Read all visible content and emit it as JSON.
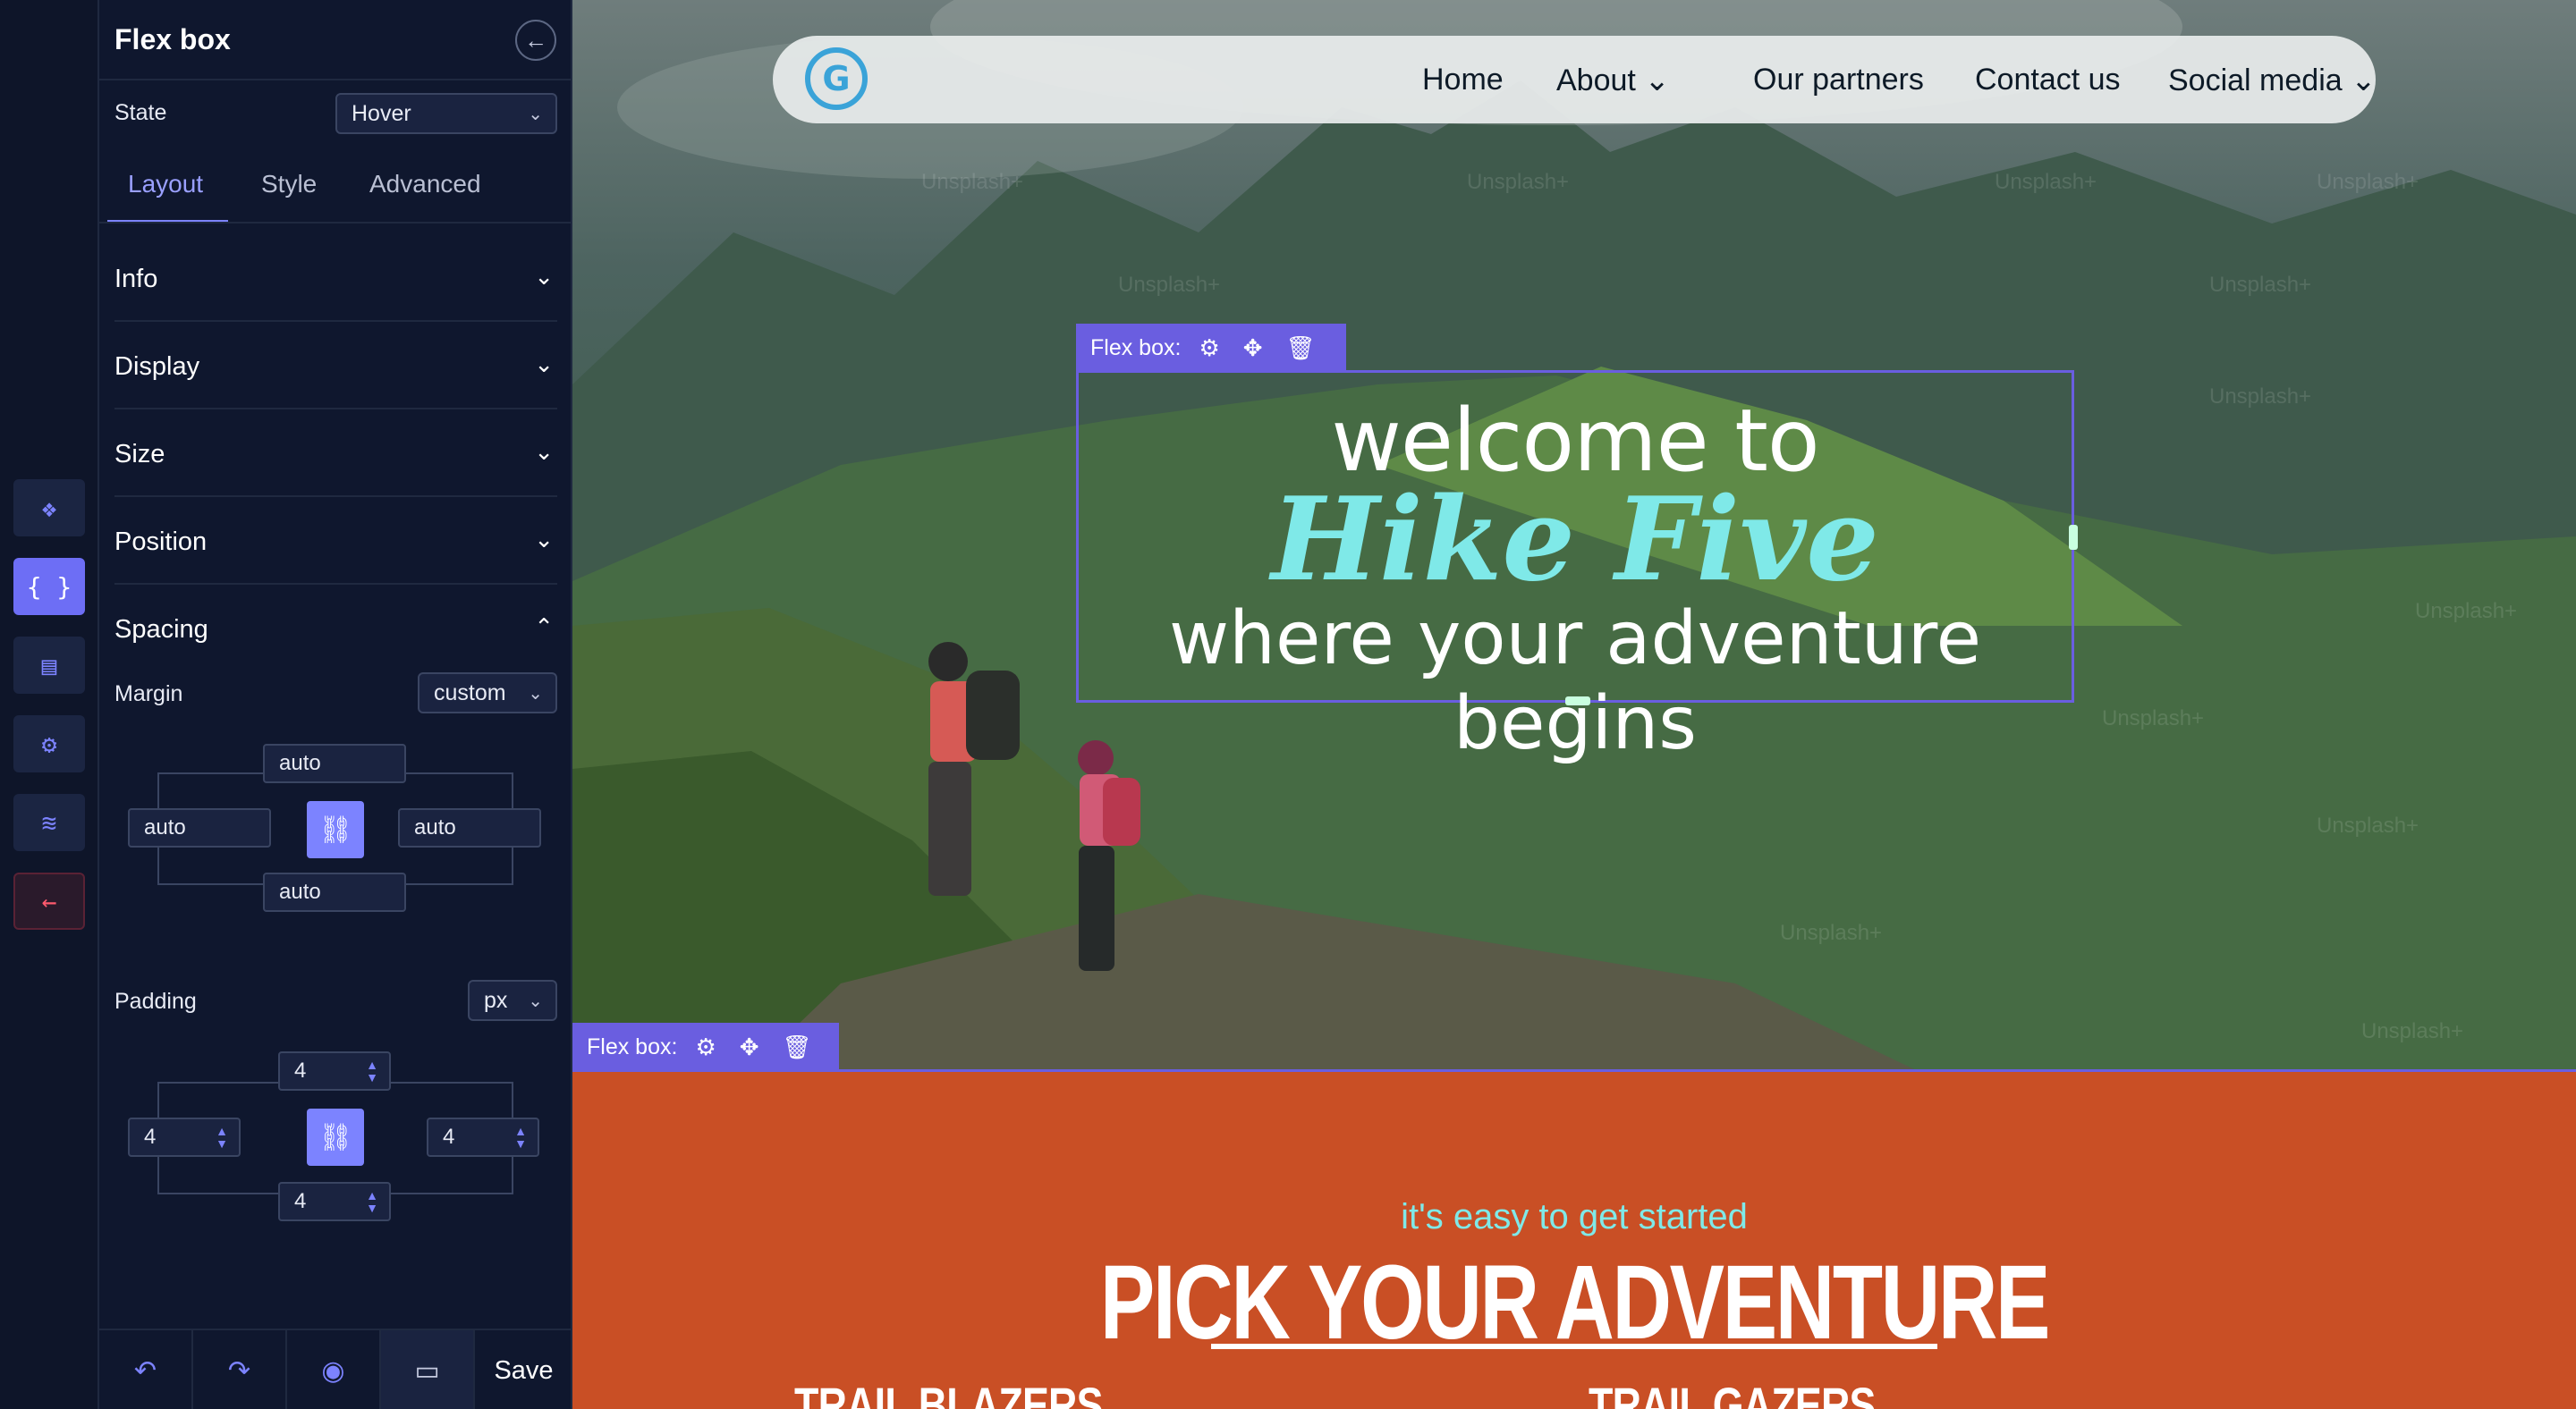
{
  "panel": {
    "title": "Flex box",
    "state_label": "State",
    "state_value": "Hover",
    "tabs": [
      {
        "label": "Layout",
        "active": true
      },
      {
        "label": "Style",
        "active": false
      },
      {
        "label": "Advanced",
        "active": false
      }
    ],
    "sections": [
      "Info",
      "Display",
      "Size",
      "Position",
      "Spacing"
    ],
    "margin": {
      "label": "Margin",
      "unit": "custom",
      "top": "auto",
      "left": "auto",
      "right": "auto",
      "bottom": "auto"
    },
    "padding": {
      "label": "Padding",
      "unit": "px",
      "top": "4",
      "left": "4",
      "right": "4",
      "bottom": "4"
    },
    "save_label": "Save"
  },
  "rail": {
    "icons": [
      "components-icon",
      "code-braces-icon",
      "book-icon",
      "gear-icon",
      "layers-icon",
      "exit-arrow-icon"
    ]
  },
  "site": {
    "nav": [
      "Home",
      "About",
      "Our partners",
      "Contact us",
      "Social media"
    ],
    "hero_welcome": "welcome to",
    "hero_name": "Hike Five",
    "hero_sub": "where your adventure begins",
    "flexbox_label": "Flex box:",
    "watermark": "Unsplash+",
    "eyebrow": "it's easy to get started",
    "section_title": "PICK YOUR ADVENTURE",
    "card_1": "TRAIL BLAZERS",
    "card_2": "TRAIL GAZERS"
  },
  "colors": {
    "accent": "#7c83ff",
    "selection": "#6a5ee0",
    "hero_accent": "#7fe9e8",
    "section_bg": "#c94f25",
    "panel_bg": "#0f172e"
  }
}
